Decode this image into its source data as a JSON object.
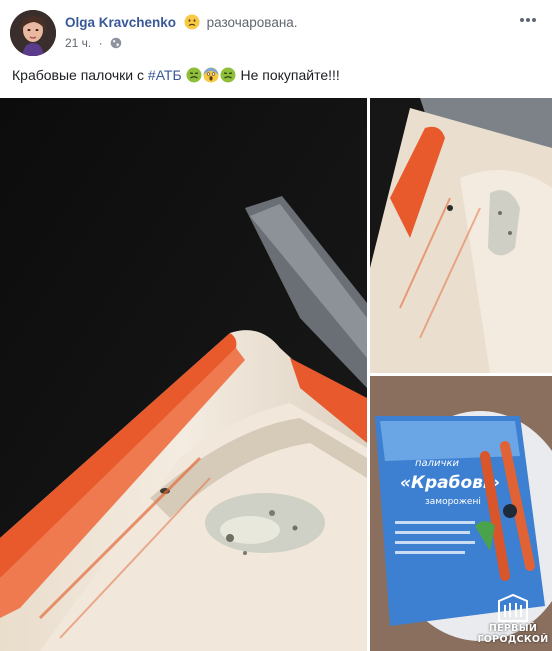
{
  "post": {
    "author_name": "Olga Kravchenko",
    "feeling": "разочарована.",
    "feeling_icon": "disappointed-face-icon",
    "time": "21 ч.",
    "separator": "·",
    "privacy_icon": "globe-icon",
    "text_before_hashtag": "Крабовые палочки с ",
    "hashtag": "#АТБ",
    "text_after_emojis": " Не покупайте!!!",
    "emojis": [
      "nauseated-face-icon",
      "screaming-face-icon",
      "nauseated-face-icon"
    ]
  },
  "photos": [
    {
      "name": "crab-stick-moldy-closeup"
    },
    {
      "name": "crab-stick-moldy-open"
    },
    {
      "name": "crab-sticks-package"
    }
  ],
  "package": {
    "brand_line_1": "палички",
    "brand_line_2": "«Крабові»",
    "brand_line_3": "заморожені"
  },
  "watermark": {
    "line1": "ПЕРВЫЙ",
    "line2": "ГОРОДСКОЙ"
  },
  "colors": {
    "link": "#385898",
    "meta": "#606770",
    "text": "#1c1e21"
  }
}
